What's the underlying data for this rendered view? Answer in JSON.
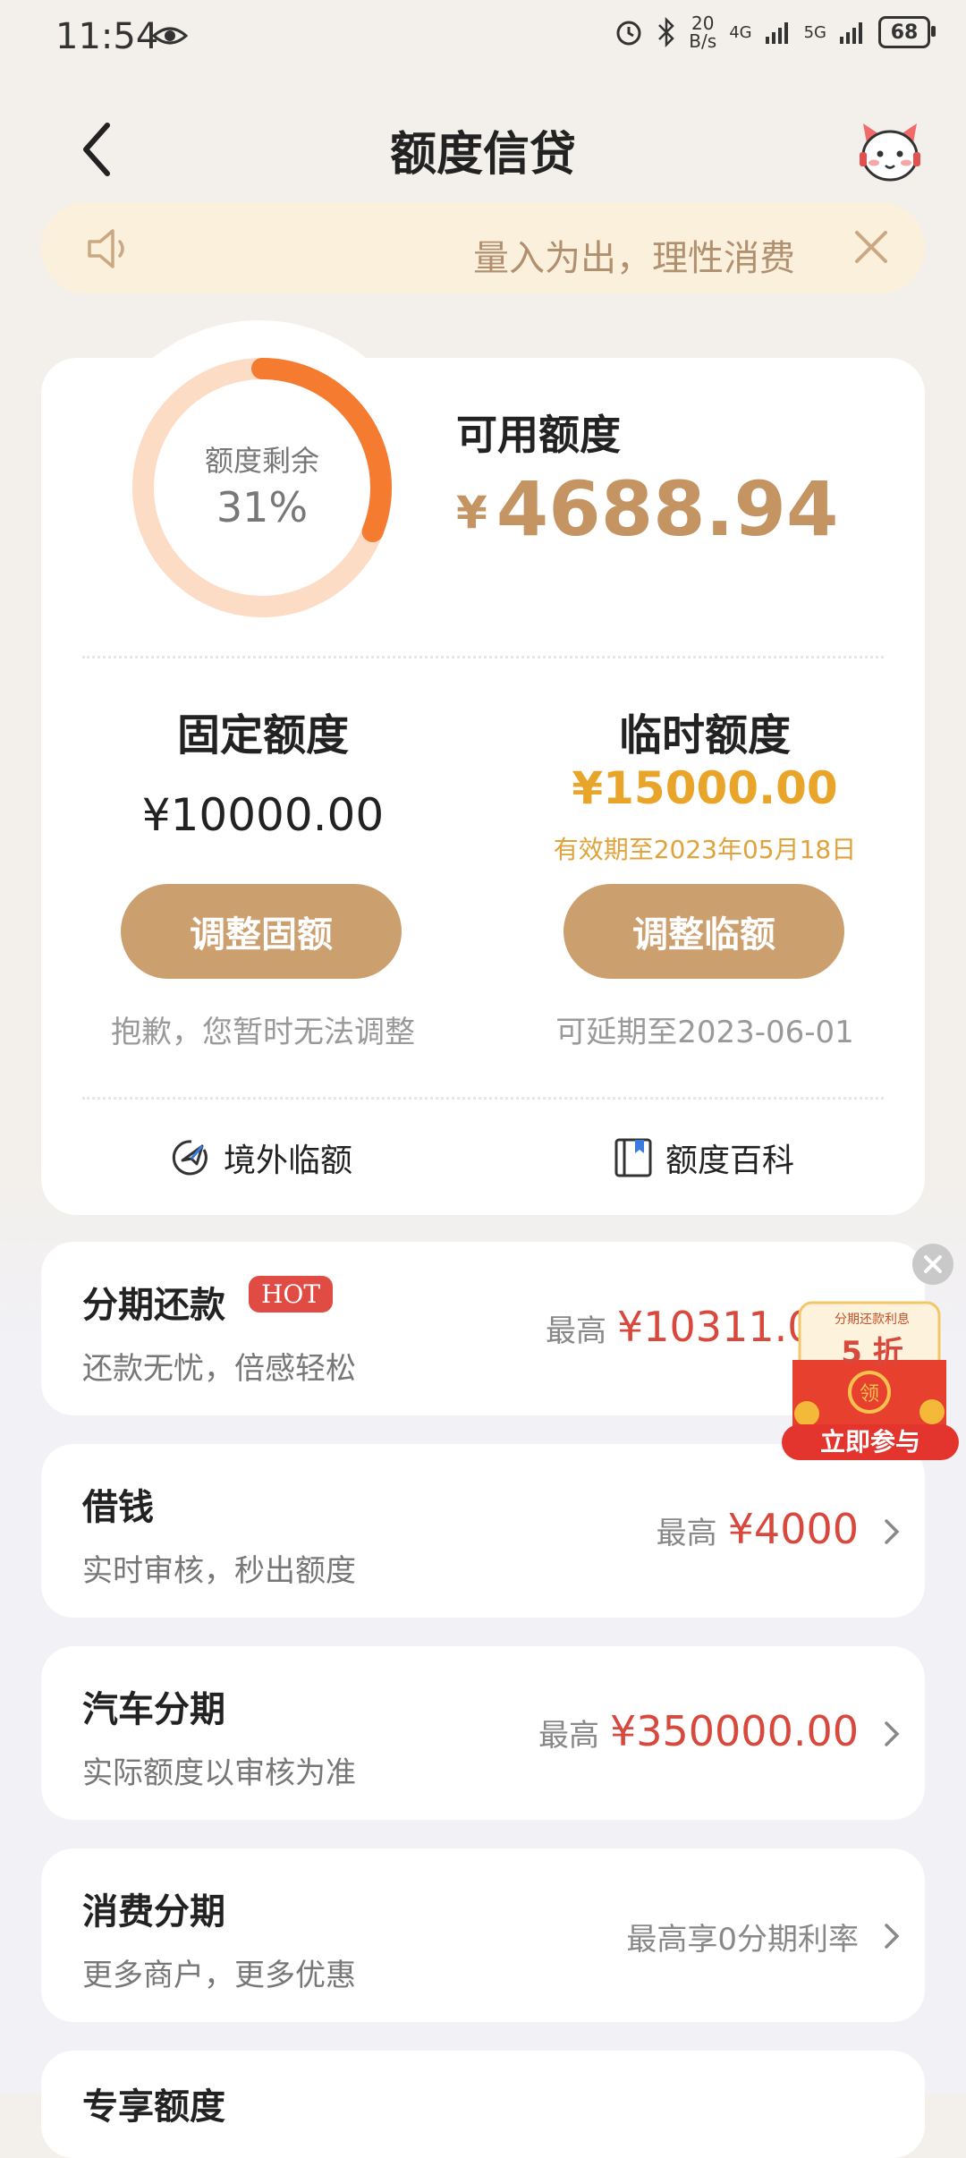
{
  "status_bar": {
    "time": "11:54",
    "net_speed_value": "20",
    "net_speed_unit": "B/s",
    "net_4g": "4G",
    "net_5g": "5G",
    "battery": "68"
  },
  "header": {
    "title": "额度信贷"
  },
  "notice": {
    "text": "量入为出，理性消费"
  },
  "credit": {
    "ring_label": "额度剩余",
    "ring_percent_text": "31%",
    "ring_fraction": 0.31,
    "available_label": "可用额度",
    "available_currency": "¥",
    "available_amount": "4688.94",
    "fixed": {
      "title": "固定额度",
      "amount": "¥10000.00",
      "button": "调整固额",
      "note": "抱歉，您暂时无法调整"
    },
    "temporary": {
      "title": "临时额度",
      "amount": "¥15000.00",
      "valid_until": "有效期至2023年05月18日",
      "button": "调整临额",
      "note": "可延期至2023-06-01"
    },
    "links": {
      "overseas": "境外临额",
      "wiki": "额度百科"
    }
  },
  "services": [
    {
      "title": "分期还款",
      "badge": "HOT",
      "subtitle": "还款无忧，倍感轻松",
      "prefix": "最高",
      "amount": "¥10311.00"
    },
    {
      "title": "借钱",
      "subtitle": "实时审核，秒出额度",
      "prefix": "最高",
      "amount": "¥4000"
    },
    {
      "title": "汽车分期",
      "subtitle": "实际额度以审核为准",
      "prefix": "最高",
      "amount": "¥350000.00"
    },
    {
      "title": "消费分期",
      "subtitle": "更多商户，更多优惠",
      "prefix": "最高享0分期利率",
      "amount": ""
    },
    {
      "title": "专享额度"
    }
  ],
  "promo": {
    "top_text": "分期还款利息",
    "discount": "5 折",
    "seal": "领",
    "button": "立即参与"
  },
  "colors": {
    "accent_gold": "#cc9f6e",
    "amount_red": "#d8483c",
    "temp_yellow": "#e8a52a",
    "ring_orange": "#f47b30",
    "ring_track": "#fcdcc5"
  }
}
